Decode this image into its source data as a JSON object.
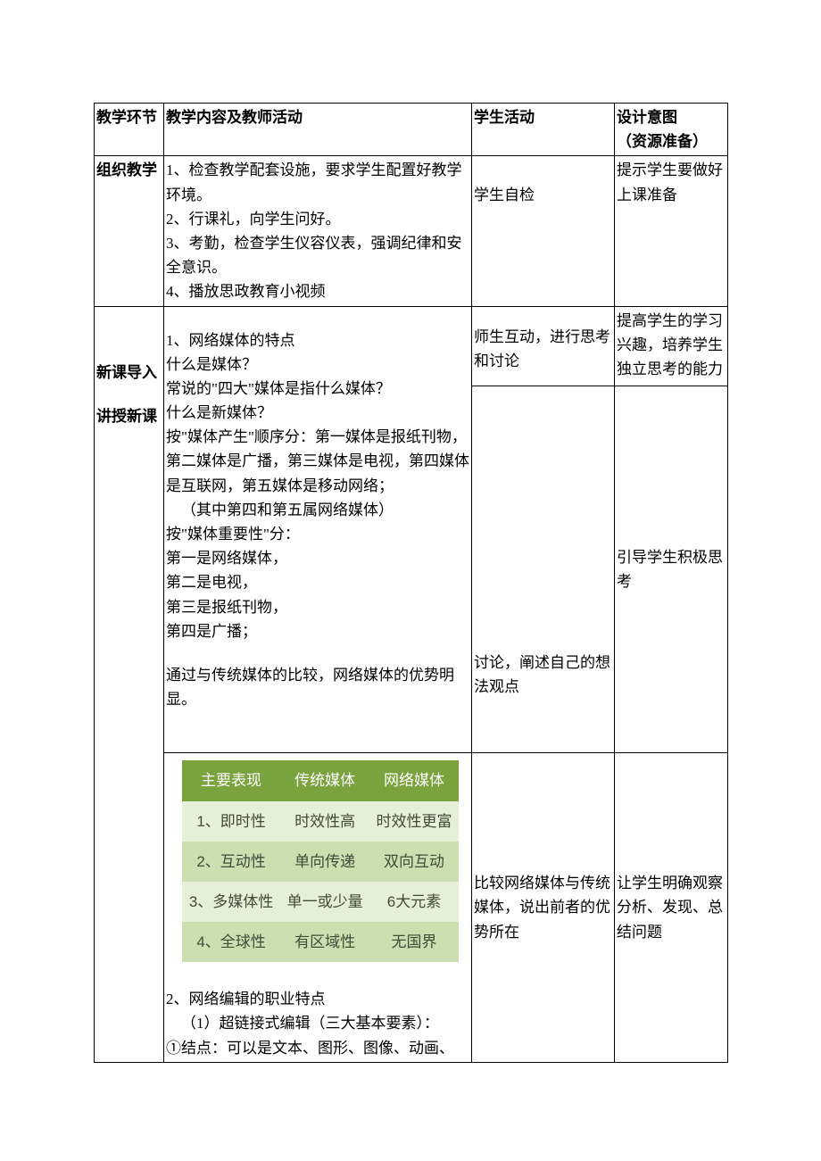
{
  "headers": {
    "col1": "教学环节",
    "col2": "教学内容及教师活动",
    "col3": "学生活动",
    "col4a": "设计意图",
    "col4b": "（资源准备）"
  },
  "row1": {
    "stage": "组织教学",
    "content": "1、检查教学配套设施，要求学生配置好教学环境。\n2、行课礼，向学生问好。\n3、考勤，检查学生仪容仪表，强调纪律和安全意识。\n4、播放思政教育小视频",
    "student": "学生自检",
    "design": "提示学生要做好上课准备"
  },
  "row2a": {
    "stage": "新课导入"
  },
  "row2b": {
    "stage": "讲授新课"
  },
  "content_block": {
    "l1": "1、网络媒体的特点",
    "l2": "什么是媒体？",
    "l3": "常说的\"四大\"媒体是指什么媒体？",
    "l4": "什么是新媒体？",
    "l5": "按\"媒体产生\"顺序分：第一媒体是报纸刊物，第二媒体是广播，第三媒体是电视，第四媒体是互联网，第五媒体是移动网络；",
    "l6": "（其中第四和第五属网络媒体）",
    "l7": "按\"媒体重要性\"分：",
    "l8": "第一是网络媒体，",
    "l9": "第二是电视，",
    "l10": "第三是报纸刊物，",
    "l11": "第四是广播；",
    "l12": "通过与传统媒体的比较，网络媒体的优势明显。"
  },
  "student2a": "师生互动，进行思考和讨论",
  "student2b": "讨论，阐述自己的想法观点",
  "design2a": "提高学生的学习兴趣，培养学生独立思考的能力",
  "design2b": "引导学生积极思考",
  "chart_data": {
    "type": "table",
    "headers": [
      "主要表现",
      "传统媒体",
      "网络媒体"
    ],
    "rows": [
      [
        "1、即时性",
        "时效性高",
        "时效性更富"
      ],
      [
        "2、互动性",
        "单向传递",
        "双向互动"
      ],
      [
        "3、多媒体性",
        "单一或少量",
        "6大元素"
      ],
      [
        "4、全球性",
        "有区域性",
        "无国界"
      ]
    ]
  },
  "content_block2": {
    "l1": "2、网络编辑的职业特点",
    "l2": "（1）超链接式编辑（三大基本要素）：",
    "l3": "①结点：可以是文本、图形、图像、动画、"
  },
  "student3": "比较网络媒体与传统媒体，说出前者的优势所在",
  "design3": "让学生明确观察分析、发现、总结问题"
}
